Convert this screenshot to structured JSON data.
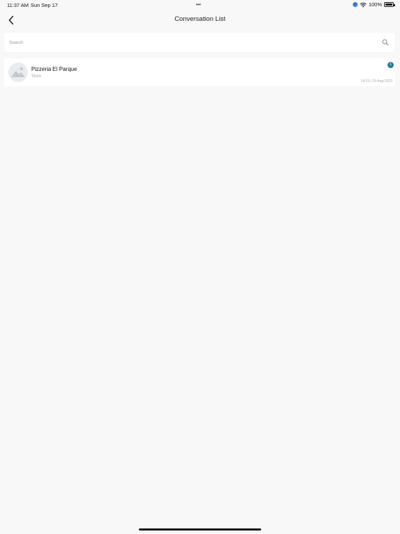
{
  "status_bar": {
    "time": "11:37 AM",
    "date": "Sun Sep 17",
    "dots": "•••",
    "battery": "100%",
    "icons": [
      "location-icon",
      "wifi-icon",
      "battery-icon"
    ]
  },
  "header": {
    "title": "Conversation List",
    "back_icon": "chevron-left-icon"
  },
  "search": {
    "placeholder": "Search",
    "value": "",
    "icon": "search-icon"
  },
  "conversations": [
    {
      "name": "Pizzeria El Parque",
      "subtitle": "Store",
      "unread": "1",
      "time": "14:15 | 25-Aug-2023",
      "avatar": "image-placeholder-icon"
    }
  ],
  "colors": {
    "background": "#f8f8f8",
    "card": "#ffffff",
    "badge": "#1f7f99",
    "muted_text": "#a8a8a8"
  }
}
